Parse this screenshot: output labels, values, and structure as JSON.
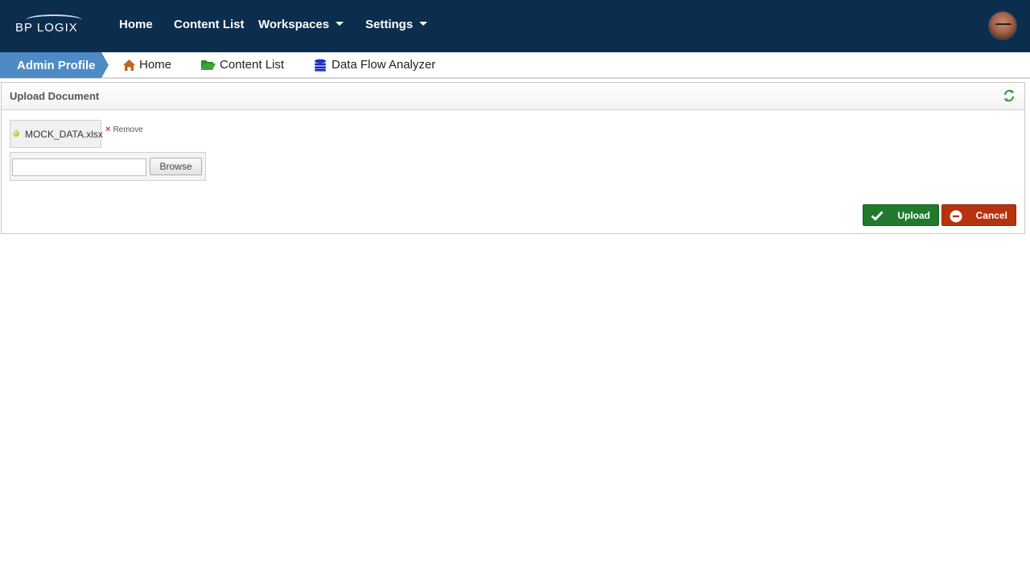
{
  "topbar": {
    "logo_text": "BP LOGIX",
    "nav": {
      "home": "Home",
      "content_list": "Content List",
      "workspaces": "Workspaces",
      "settings": "Settings"
    }
  },
  "breadcrumb": {
    "active": "Admin Profile",
    "items": {
      "home": "Home",
      "content_list": "Content List",
      "data_flow": "Data Flow Analyzer"
    }
  },
  "panel": {
    "title": "Upload Document",
    "file_name": "MOCK_DATA.xlsx",
    "remove_label": "Remove",
    "file_input_value": "",
    "browse_label": "Browse",
    "upload_label": "Upload",
    "cancel_label": "Cancel"
  },
  "colors": {
    "topbar": "#0b2d4e",
    "active_crumb": "#4e8ac4",
    "upload_button": "#1f7a2b",
    "cancel_button": "#b5330e",
    "home_icon": "#c0651d",
    "folder_icon": "#2c8a2c",
    "database_icon": "#1a2fc9"
  },
  "icons": {
    "home": "home-icon",
    "folder": "folder-open-icon",
    "database": "database-icon",
    "refresh": "refresh-icon",
    "check": "check-icon",
    "minus": "minus-circle-icon",
    "remove": "close-icon",
    "status_dot": "status-dot-icon"
  }
}
